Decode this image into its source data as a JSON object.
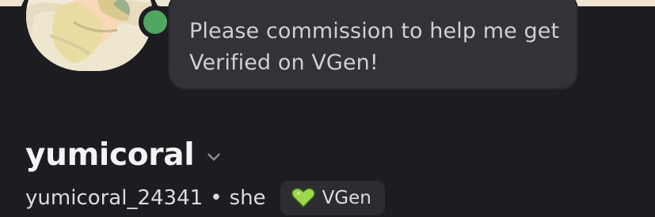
{
  "bubble": {
    "text": "Please commission to help me get Verified on VGen!"
  },
  "profile": {
    "display_name": "yumicoral",
    "username": "yumicoral_24341",
    "separator": "•",
    "pronouns": "she",
    "status": "online"
  },
  "badge": {
    "label": "VGen",
    "icon": "heart-icon"
  },
  "colors": {
    "background": "#1c1c21",
    "bubble": "#323238",
    "status_online": "#4fa660",
    "badge_heart": "#9ed84a"
  }
}
